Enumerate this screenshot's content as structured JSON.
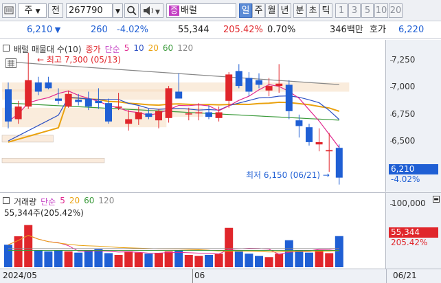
{
  "toolbar": {
    "market_label": "주",
    "prev_label": "전",
    "code": "267790",
    "stock_badge": "증",
    "stock_name": "배럴",
    "periods": [
      "일",
      "주",
      "월",
      "년",
      "분",
      "초",
      "틱"
    ],
    "intervals": [
      "1",
      "3",
      "5",
      "10",
      "20"
    ]
  },
  "quote": {
    "price": "6,210",
    "change": "260",
    "change_pct": "-4.02%",
    "volume": "55,344",
    "volume_ratio": "205.42%",
    "turnover": "0.70%",
    "amount": "346백만",
    "ask_label": "호가",
    "ask_price": "6,220"
  },
  "legend": {
    "indicator": "배럴 매물대 수(10)",
    "close_label": "종가",
    "ma_label": "단순",
    "ma_periods": [
      "5",
      "10",
      "20",
      "60",
      "120"
    ],
    "volume_label": "거래량",
    "volume_readout": "55,344주(205.42%)"
  },
  "annotations": {
    "high": "최고 7,300 (05/13)",
    "low": "최저 6,150 (06/21)"
  },
  "axis": {
    "price_ticks": [
      "7,250",
      "7,000",
      "6,750",
      "6,500"
    ],
    "current_price": "6,210",
    "current_pct": "-4.02%",
    "volume_tick": "100,000",
    "current_volume": "55,344",
    "current_volume_pct": "205.42%",
    "dates": [
      "2024/05",
      "06",
      "06/21"
    ]
  },
  "colors": {
    "up": "#e0262b",
    "down": "#1f5fd4",
    "ma5": "#e0288f",
    "ma10": "#2d51c4",
    "ma20": "#eaa20f",
    "ma60": "#3a9a3a",
    "ma120": "#888888",
    "badge": "#c43fc4"
  },
  "chart_data": {
    "type": "candlestick",
    "candles": [
      {
        "o": 6980,
        "h": 7040,
        "l": 6640,
        "c": 6700
      },
      {
        "o": 6720,
        "h": 6880,
        "l": 6680,
        "c": 6830
      },
      {
        "o": 6830,
        "h": 7300,
        "l": 6810,
        "c": 7060
      },
      {
        "o": 7040,
        "h": 7090,
        "l": 6930,
        "c": 6960
      },
      {
        "o": 7040,
        "h": 7090,
        "l": 6980,
        "c": 6990
      },
      {
        "o": 6900,
        "h": 6990,
        "l": 6850,
        "c": 6880
      },
      {
        "o": 6830,
        "h": 6970,
        "l": 6820,
        "c": 6940
      },
      {
        "o": 6890,
        "h": 6940,
        "l": 6840,
        "c": 6870
      },
      {
        "o": 6900,
        "h": 6960,
        "l": 6800,
        "c": 6830
      },
      {
        "o": 6880,
        "h": 6990,
        "l": 6810,
        "c": 6860
      },
      {
        "o": 6860,
        "h": 6900,
        "l": 6680,
        "c": 6700
      },
      {
        "o": 6820,
        "h": 6950,
        "l": 6800,
        "c": 6830
      },
      {
        "o": 6680,
        "h": 6800,
        "l": 6620,
        "c": 6720
      },
      {
        "o": 6720,
        "h": 6830,
        "l": 6670,
        "c": 6780
      },
      {
        "o": 6770,
        "h": 6810,
        "l": 6720,
        "c": 6740
      },
      {
        "o": 6710,
        "h": 6810,
        "l": 6640,
        "c": 6790
      },
      {
        "o": 6730,
        "h": 7010,
        "l": 6690,
        "c": 6990
      },
      {
        "o": 6960,
        "h": 7120,
        "l": 6900,
        "c": 6900
      },
      {
        "o": 6770,
        "h": 6820,
        "l": 6710,
        "c": 6770
      },
      {
        "o": 6770,
        "h": 6860,
        "l": 6710,
        "c": 6780
      },
      {
        "o": 6780,
        "h": 6840,
        "l": 6720,
        "c": 6740
      },
      {
        "o": 6730,
        "h": 6830,
        "l": 6700,
        "c": 6780
      },
      {
        "o": 6880,
        "h": 7130,
        "l": 6820,
        "c": 7110
      },
      {
        "o": 7140,
        "h": 7200,
        "l": 6990,
        "c": 7010
      },
      {
        "o": 7080,
        "h": 7130,
        "l": 6920,
        "c": 6960
      },
      {
        "o": 7060,
        "h": 7120,
        "l": 6990,
        "c": 7020
      },
      {
        "o": 6970,
        "h": 7080,
        "l": 6920,
        "c": 7010
      },
      {
        "o": 7010,
        "h": 7200,
        "l": 6950,
        "c": 7030
      },
      {
        "o": 7020,
        "h": 7060,
        "l": 6720,
        "c": 6790
      },
      {
        "o": 6710,
        "h": 6760,
        "l": 6560,
        "c": 6660
      },
      {
        "o": 6650,
        "h": 6680,
        "l": 6490,
        "c": 6520
      },
      {
        "o": 6500,
        "h": 6640,
        "l": 6440,
        "c": 6520
      },
      {
        "o": 6440,
        "h": 6600,
        "l": 6260,
        "c": 6450
      },
      {
        "o": 6470,
        "h": 6500,
        "l": 6150,
        "c": 6210
      }
    ],
    "volume": [
      40000,
      55000,
      75000,
      30000,
      28000,
      30000,
      28000,
      26000,
      30000,
      32000,
      25000,
      22000,
      28000,
      26000,
      24000,
      25000,
      28000,
      30000,
      22000,
      20000,
      22000,
      24000,
      70000,
      28000,
      24000,
      20000,
      18000,
      24000,
      48000,
      30000,
      26000,
      30000,
      25000,
      55344
    ],
    "ylim": [
      6100,
      7400
    ],
    "volume_max": 110000
  }
}
